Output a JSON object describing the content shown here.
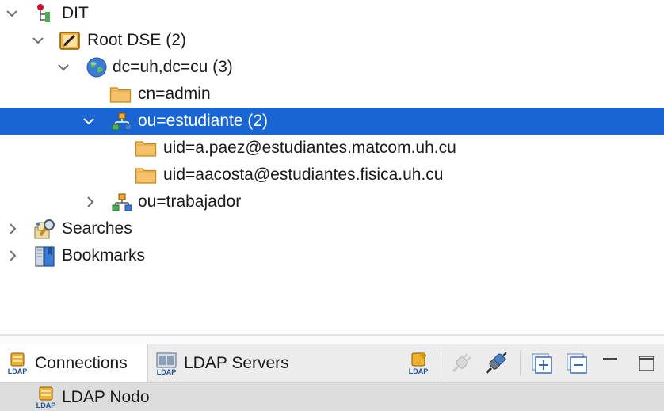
{
  "tree": {
    "dit": "DIT",
    "root_dse": "Root DSE (2)",
    "domain": "dc=uh,dc=cu (3)",
    "admin": "cn=admin",
    "estudiante": "ou=estudiante (2)",
    "uid1": "uid=a.paez@estudiantes.matcom.uh.cu",
    "uid2": "uid=aacosta@estudiantes.fisica.uh.cu",
    "trabajador": "ou=trabajador",
    "searches": "Searches",
    "bookmarks": "Bookmarks"
  },
  "tabs": {
    "connections": "Connections",
    "ldap_servers": "LDAP Servers"
  },
  "toolbar": {
    "icons": [
      "new-connection-icon",
      "disconnect-icon",
      "connect-icon",
      "expand-all-icon",
      "collapse-all-icon",
      "minimize-icon",
      "maximize-icon"
    ]
  },
  "connections": {
    "item": "LDAP Nodo"
  },
  "colors": {
    "selection": "#1966d2",
    "folder": "#f5c26b",
    "tab_bar": "#ececec"
  }
}
